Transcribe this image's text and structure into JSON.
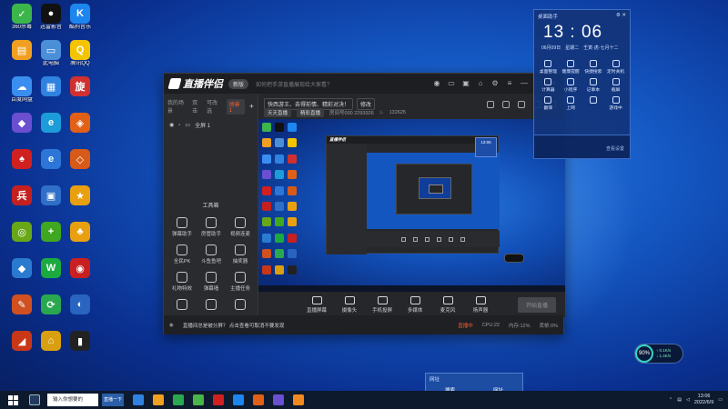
{
  "desktop": {
    "icons": [
      {
        "label": "360杀毒",
        "color": "#3cb54a",
        "glyph": "✓"
      },
      {
        "label": "迅雷影音",
        "color": "#111111",
        "glyph": "●"
      },
      {
        "label": "酷狗音乐",
        "color": "#1c86ee",
        "glyph": "K"
      },
      {
        "label": "",
        "color": "#f0a020",
        "glyph": "▤"
      },
      {
        "label": "此电脑",
        "color": "#4a8fd8",
        "glyph": "▭"
      },
      {
        "label": "腾讯QQ",
        "color": "#f5c400",
        "glyph": "Q"
      },
      {
        "label": "百度网盘",
        "color": "#3a8ef0",
        "glyph": "☁"
      },
      {
        "label": "",
        "color": "#2f82e0",
        "glyph": "▦"
      },
      {
        "label": "",
        "color": "#d03030",
        "glyph": "旋"
      },
      {
        "label": "",
        "color": "#6a4fd0",
        "glyph": "◆"
      },
      {
        "label": "",
        "color": "#1c9cd8",
        "glyph": "e"
      },
      {
        "label": "",
        "color": "#e06018",
        "glyph": "◈"
      },
      {
        "label": "",
        "color": "#d02020",
        "glyph": "♠"
      },
      {
        "label": "",
        "color": "#2c76d8",
        "glyph": "e"
      },
      {
        "label": "",
        "color": "#d85a18",
        "glyph": "◇"
      },
      {
        "label": "",
        "color": "#c42020",
        "glyph": "兵"
      },
      {
        "label": "",
        "color": "#2f6fc8",
        "glyph": "▣"
      },
      {
        "label": "",
        "color": "#e8a010",
        "glyph": "★"
      },
      {
        "label": "",
        "color": "#68a818",
        "glyph": "◎"
      },
      {
        "label": "",
        "color": "#40a820",
        "glyph": "+"
      },
      {
        "label": "",
        "color": "#e8a010",
        "glyph": "♣"
      },
      {
        "label": "",
        "color": "#2a7ad0",
        "glyph": "◆"
      },
      {
        "label": "",
        "color": "#1aaa40",
        "glyph": "W"
      },
      {
        "label": "",
        "color": "#c82020",
        "glyph": "◉"
      },
      {
        "label": "",
        "color": "#d05020",
        "glyph": "✎"
      },
      {
        "label": "",
        "color": "#2aa850",
        "glyph": "⟳"
      },
      {
        "label": "",
        "color": "#2864c0",
        "glyph": "◐"
      },
      {
        "label": "",
        "color": "#c83818",
        "glyph": "◢"
      },
      {
        "label": "",
        "color": "#d8a010",
        "glyph": "⌂"
      },
      {
        "label": "",
        "color": "#222222",
        "glyph": "▮"
      }
    ]
  },
  "app": {
    "title": "直播伴侣",
    "version_badge": "新版",
    "promo": "如何把手游直播展现给大家看？",
    "left_tabs": [
      "我的场景",
      "双击",
      "可改选",
      "场景1"
    ],
    "scene_label": "全屏 1",
    "tools_title": "工具箱",
    "tools": [
      "弹幕助手",
      "房管助手",
      "视频连麦",
      "全民PK",
      "斗鱼鱼吧",
      "抽奖器",
      "礼物特效",
      "弹幕墙",
      "主播任务",
      "",
      "",
      ""
    ],
    "room_chips": [
      "快西游王、去得前情、精彩对决！",
      "修改"
    ],
    "room_sub": [
      "天天直播",
      "精彩直播",
      "房间号000 2293926",
      "132625"
    ],
    "controls": [
      "直播屏幕",
      "摄像头",
      "手机投屏",
      "多媒体",
      "麦克风",
      "扬声器"
    ],
    "go_live": "开始直播",
    "status": {
      "notice": "直播间总是被分屏？ 点击查看可取消不要发现",
      "items": [
        "CPU:22",
        "内存:12%",
        "丢帧:0%"
      ],
      "warn": "直播中"
    }
  },
  "nested": {
    "title": "直播伴侣",
    "widget_time": "13:06"
  },
  "widget": {
    "header": "桌面助手",
    "time": "13 : 06",
    "date": [
      "06月09日",
      "星期二",
      "壬寅·虎·七月十二"
    ],
    "items": [
      "桌面整理",
      "健康提醒",
      "快捷搜索",
      "定时关机",
      "计算器",
      "小程序",
      "记事本",
      "截屏",
      "翻译",
      "上网",
      "",
      "游戏中"
    ],
    "footer": "查看设置"
  },
  "popup": {
    "header": "网址",
    "items": [
      "搜索",
      "网址"
    ]
  },
  "gauge": {
    "value": "90",
    "unit": "%",
    "up": "↑ 0.1K/s",
    "down": "↓ 1.4K/s"
  },
  "taskbar": {
    "search": "输入你想要的",
    "active_app": "直播一下",
    "time": "13:06",
    "date": "2022/6/9",
    "icon_colors": [
      "#2f82e0",
      "#f0a020",
      "#2aa850",
      "#49b548",
      "#d02020",
      "#1c86ee",
      "#e06018",
      "#6a4fd0",
      "#f08a20"
    ]
  }
}
